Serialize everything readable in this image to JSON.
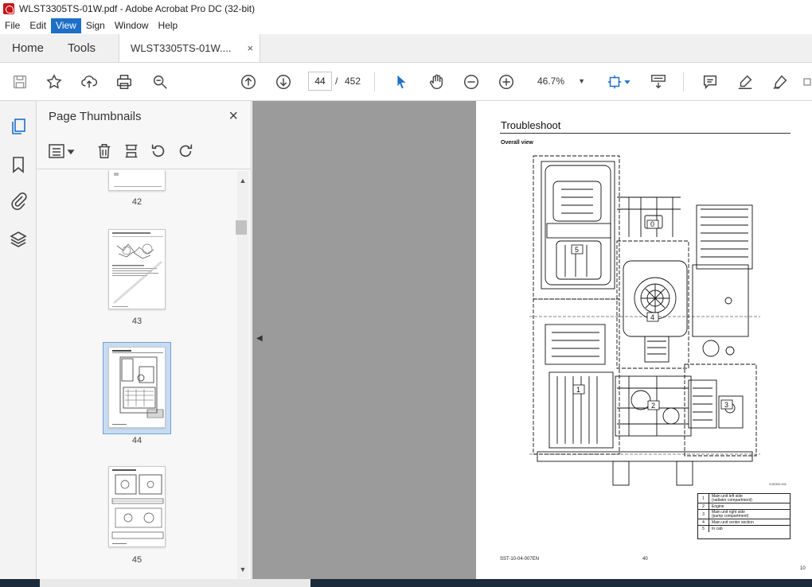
{
  "window": {
    "title": "WLST3305TS-01W.pdf - Adobe Acrobat Pro DC (32-bit)"
  },
  "menu": {
    "items": [
      "File",
      "Edit",
      "View",
      "Sign",
      "Window",
      "Help"
    ],
    "active": "View"
  },
  "tabs": {
    "home": "Home",
    "tools": "Tools",
    "document": "WLST3305TS-01W....",
    "close": "×"
  },
  "toolbar": {
    "current_page": "44",
    "page_separator": "/",
    "total_pages": "452",
    "zoom": "46.7%",
    "icons": [
      "save-icon",
      "bookmark-star-icon",
      "upload-icon",
      "print-icon",
      "zoom-search-icon",
      "page-up-icon",
      "page-down-icon",
      "select-cursor-icon",
      "hand-icon",
      "zoom-out-icon",
      "zoom-in-icon",
      "fit-page-icon",
      "scroll-mode-icon",
      "comment-icon",
      "highlight-icon",
      "sign-icon"
    ]
  },
  "sidebar": {
    "icons": [
      "page-thumbnails-icon",
      "bookmarks-icon",
      "attachments-icon",
      "layers-icon"
    ]
  },
  "thumbnails": {
    "title": "Page Thumbnails",
    "close": "×",
    "pages": [
      "42",
      "43",
      "44",
      "45"
    ],
    "selected": "44"
  },
  "document": {
    "heading": "Troubleshoot",
    "subheading": "Overall view",
    "drawing_code": "SJS000-001",
    "footer_left": "SST-10-04-007EN",
    "footer_center": "40",
    "footer_right": "10",
    "legend": [
      {
        "num": "1",
        "text": "Main unit left side\n(radiator compartment)"
      },
      {
        "num": "2",
        "text": "Engine"
      },
      {
        "num": "3",
        "text": "Main unit right side\n(pump compartment)"
      },
      {
        "num": "4",
        "text": "Main unit center section"
      },
      {
        "num": "5",
        "text": "In cab"
      }
    ],
    "callouts": [
      "0",
      "1",
      "2",
      "3",
      "4",
      "5"
    ]
  },
  "colors": {
    "accent": "#1e6fc8",
    "doc_background": "#9b9b9b",
    "selected_thumb": "#c8dcf1"
  }
}
